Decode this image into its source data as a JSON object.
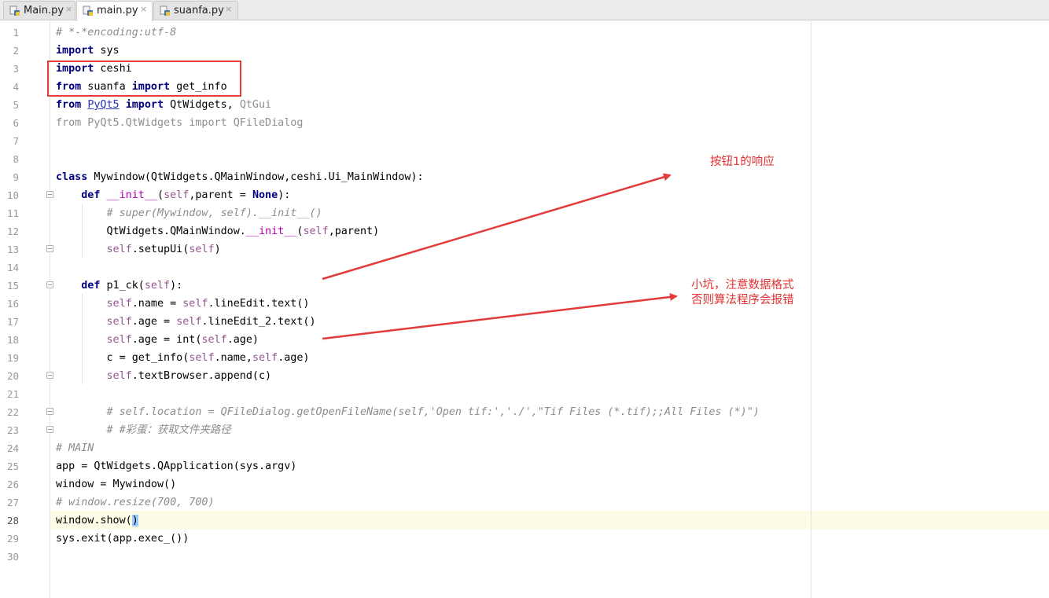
{
  "tabs": [
    {
      "label": "Main.py",
      "close": "×",
      "active": false
    },
    {
      "label": "main.py",
      "close": "×",
      "active": true
    },
    {
      "label": "suanfa.py",
      "close": "×",
      "active": false
    }
  ],
  "editor": {
    "current_line": 28,
    "line_numbers": [
      "1",
      "2",
      "3",
      "4",
      "5",
      "6",
      "7",
      "8",
      "9",
      "10",
      "11",
      "12",
      "13",
      "14",
      "15",
      "16",
      "17",
      "18",
      "19",
      "20",
      "21",
      "22",
      "23",
      "24",
      "25",
      "26",
      "27",
      "28",
      "29",
      "30"
    ]
  },
  "annotations": {
    "note_button": "按钮1的响应",
    "note_warning_line1": "小坑，注意数据格式",
    "note_warning_line2": "否则算法程序会报错",
    "accent_color": "#e33b3b"
  },
  "code": {
    "l1": "# *-*encoding:utf-8",
    "l2_kw": "import",
    "l2_rest": " sys",
    "l3_kw": "import",
    "l3_rest": " ceshi",
    "l4_kw1": "from",
    "l4_mid": " suanfa ",
    "l4_kw2": "import",
    "l4_rest": " get_info",
    "l5_kw1": "from",
    "l5_mod": "PyQt5",
    "l5_kw2": "import",
    "l5_a": " QtWidgets, ",
    "l5_b": "QtGui",
    "l6": "from PyQt5.QtWidgets import QFileDialog",
    "l9_kw": "class",
    "l9_rest": " Mywindow(QtWidgets.QMainWindow,ceshi.Ui_MainWindow):",
    "l10_kw": "def",
    "l10_fn": "__init__",
    "l10_p1": "(",
    "l10_self": "self",
    "l10_p2": ",parent = ",
    "l10_none": "None",
    "l10_p3": "):",
    "l11": "# super(Mywindow, self).__init__()",
    "l12_a": "QtWidgets.QMainWindow.",
    "l12_fn": "__init__",
    "l12_b": "(",
    "l12_self": "self",
    "l12_c": ",parent)",
    "l13_self": "self",
    "l13_a": ".setupUi(",
    "l13_self2": "self",
    "l13_b": ")",
    "l15_kw": "def",
    "l15_a": " p1_ck(",
    "l15_self": "self",
    "l15_b": "):",
    "l16_self": "self",
    "l16_a": ".name = ",
    "l16_self2": "self",
    "l16_b": ".lineEdit.text()",
    "l17_self": "self",
    "l17_a": ".age = ",
    "l17_self2": "self",
    "l17_b": ".lineEdit_2.text()",
    "l18_self": "self",
    "l18_a": ".age = int(",
    "l18_self2": "self",
    "l18_b": ".age)",
    "l19_a": "c = get_info(",
    "l19_self": "self",
    "l19_b": ".name,",
    "l19_self2": "self",
    "l19_c": ".age)",
    "l20_self": "self",
    "l20_a": ".textBrowser.append(c)",
    "l22": "# self.location = QFileDialog.getOpenFileName(self,'Open tif:','./',\"Tif Files (*.tif);;All Files (*)\")",
    "l23": "# #彩蛋：获取文件夹路径",
    "l24": "# MAIN",
    "l25": "app = QtWidgets.QApplication(sys.argv)",
    "l26": "window = Mywindow()",
    "l27": "# window.resize(700, 700)",
    "l28_a": "window.show(",
    "l28_b": ")",
    "l29": "sys.exit(app.exec_())"
  }
}
